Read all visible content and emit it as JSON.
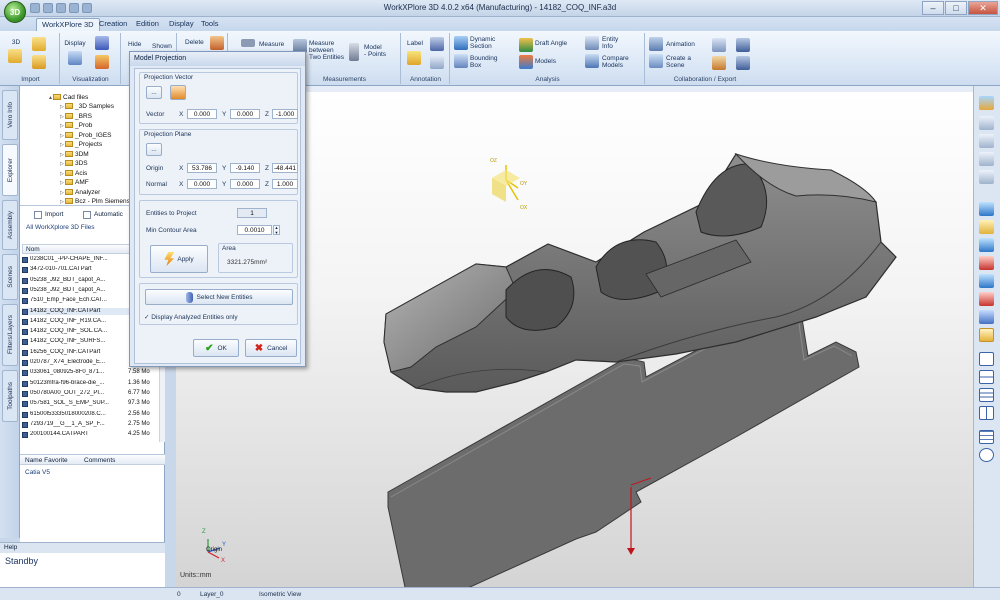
{
  "window": {
    "title": "WorkXPlore 3D 4.0.2 x64 (Manufacturing) - 14182_COQ_INF.a3d",
    "logo_text": "3D"
  },
  "ribbon_tabs": [
    "WorkXPlore 3D",
    "Creation",
    "Edition",
    "Display",
    "Tools"
  ],
  "ribbon": {
    "import": {
      "label": "Import",
      "btn": "3D"
    },
    "visualization": {
      "label": "Visualization",
      "display": "Display"
    },
    "hide": "Hide",
    "shown": "Shown",
    "delete": "Delete",
    "measure": "Measure",
    "measure_between": [
      "Measure",
      "between",
      "Two Entities"
    ],
    "model_points": [
      "Model",
      "- Points"
    ],
    "measurements_label": "Measurements",
    "annotation": {
      "label": "Annotation",
      "btn": "Label"
    },
    "analysis": {
      "label": "Analysis",
      "dynamic_section": [
        "Dynamic",
        "Section"
      ],
      "bounding_box": [
        "Bounding",
        "Box"
      ],
      "draft_angle": "Draft Angle",
      "models": "Models",
      "entity_info": [
        "Entity",
        "Info"
      ],
      "compare_models": [
        "Compare",
        "Models"
      ]
    },
    "collab": {
      "label": "Collaboration / Export",
      "animation": "Animation",
      "create_scene": [
        "Create a",
        "Scene"
      ]
    }
  },
  "left_tabs": [
    "Vero Info",
    "Explorer",
    "Assembly",
    "Scenes",
    "Filters/Layers",
    "Toolpaths"
  ],
  "explorer": {
    "tree_root": "Cad files",
    "tree_items": [
      "_3D Samples",
      "_BRS",
      "_Prob",
      "_Prob_IGES",
      "_Projects",
      "3DM",
      "3DS",
      "Acis",
      "AMF",
      "Analyzer",
      "Bcz - Plm Siemens"
    ],
    "import_label": "Import",
    "automatic_label": "Automatic",
    "filter_label": "All WorkXplore 3D Files",
    "name_header": "Nom",
    "files": [
      {
        "name": "0238C01_-PP-CHAPE_INF...",
        "size": ""
      },
      {
        "name": "3472-010-701.CATPart",
        "size": ""
      },
      {
        "name": "05238_J92_BDT_capot_A...",
        "size": ""
      },
      {
        "name": "05238_J92_BDT_capot_A...",
        "size": ""
      },
      {
        "name": "7510_Emp_Face_Ech.CAT...",
        "size": ""
      },
      {
        "name": "14182_COQ_INF.CATPart",
        "size": ""
      },
      {
        "name": "14182_COQ_INF_R19.CA...",
        "size": ""
      },
      {
        "name": "14182_COQ_INF_SOL.CA...",
        "size": ""
      },
      {
        "name": "14182_COQ_INF_SURFS...",
        "size": ""
      },
      {
        "name": "16256_COQ_INF.CATPart",
        "size": ""
      },
      {
        "name": "020787_X74_Electrode_E...",
        "size": ""
      },
      {
        "name": "033061_080925-8F0_871...",
        "size": "7.58 Mo"
      },
      {
        "name": "50123mfra-f96-brace-die_...",
        "size": "1.36 Mo"
      },
      {
        "name": "050780A00_OUT_272_PI...",
        "size": "6.77 Mo"
      },
      {
        "name": "057581_SOL_S_EMP_SUP...",
        "size": "97.3 Mo"
      },
      {
        "name": "61500l53335018000208.C...",
        "size": "2.56 Mo"
      },
      {
        "name": "7293719__G__1_A_SP_F...",
        "size": "2.75 Mo"
      },
      {
        "name": "200100144.CATPART",
        "size": "4.25 Mo"
      }
    ],
    "fav_headers": [
      "Name Favorite",
      "Comments"
    ],
    "fav_items": [
      "Catia V5"
    ]
  },
  "help": {
    "title": "Help",
    "status": "Standby"
  },
  "dialog": {
    "title": "Model Projection",
    "projection_vector": "Projection Vector",
    "vector_label": "Vector",
    "vector": [
      "0.000",
      "0.000",
      "-1.000"
    ],
    "projection_plane": "Projection Plane",
    "origin_label": "Origin",
    "origin": [
      "53.786",
      "-9.140",
      "-48.441"
    ],
    "normal_label": "Normal",
    "normal": [
      "0.000",
      "0.000",
      "1.000"
    ],
    "axis_x": "X",
    "axis_y": "Y",
    "axis_z": "Z",
    "entities_label": "Entities to Project",
    "entities_value": "1",
    "min_contour_label": "Min Contour Area",
    "min_contour_value": "0.0010",
    "apply": "Apply",
    "area_label": "Area",
    "area_value": "3321.275mm²",
    "select_new": "Select New Entities",
    "display_analyzed": "Display Analyzed Entities only",
    "ok": "OK",
    "cancel": "Cancel",
    "dots": "..."
  },
  "viewport": {
    "triad_labels": [
      "OZ",
      "OY",
      "OX"
    ],
    "corner_labels": [
      "Z",
      "Y",
      "X",
      "Origin"
    ],
    "units": "Units::mm"
  },
  "statusbar": {
    "layer_index": "0",
    "layer": "Layer_0",
    "view": "Isometric View"
  },
  "colors": {
    "ribbon_bg": "#dfe9f5",
    "viewport_top": "#ffffff",
    "model_gray": "#7a7a7a",
    "arrow_red": "#c0141c"
  }
}
